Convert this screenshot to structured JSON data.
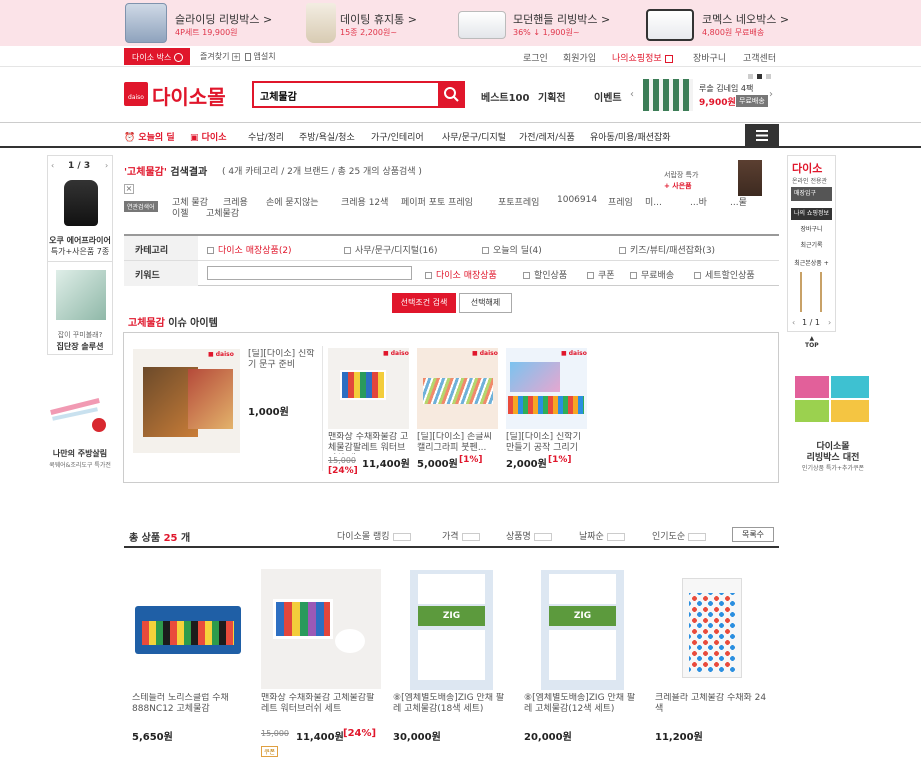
{
  "top_banner": [
    {
      "title": "슬라이딩 리빙박스 >",
      "sub": "4P세트 19,900원"
    },
    {
      "title": "데이팅 휴지통 >",
      "sub": "15종 2,200원~"
    },
    {
      "title": "모던핸들 리빙박스 >",
      "sub": "36% ↓ 1,900원~"
    },
    {
      "title": "코멕스 네오박스 >",
      "sub": "4,800원 무료배송"
    }
  ],
  "util": {
    "daiso_box": "다이소 박스",
    "bookmark": "즐겨찾기",
    "app": "앱설치",
    "login": "로그인",
    "join": "회원가입",
    "myinfo": "나의쇼핑정보",
    "cart": "장바구니",
    "support": "고객센터"
  },
  "header": {
    "logo_text": "다이소몰",
    "logo_badge": "daiso",
    "search_value": "고체물감",
    "links": [
      "베스트100",
      "기획전",
      "이벤트"
    ],
    "ad_title": "루솔 김네임 4팩",
    "ad_price": "9,900원",
    "ad_badge": "무료배송"
  },
  "gnb": {
    "deal": "오늘의 딜",
    "daiso": "다이소",
    "items": [
      "수납/정리",
      "주방/욕실/청소",
      "가구/인테리어",
      "사무/문구/디지털",
      "가전/레저/식품",
      "유아동/미용/패션잡화"
    ]
  },
  "left": {
    "pager": "1 / 3",
    "promo1_title": "오쿠 에어프라이어",
    "promo1_sub": "특가+사은품 7종",
    "promo2_sub": "잡이 꾸미볼래?",
    "promo2_title": "집단장 솔루션",
    "promo3_title": "나만의 주방살림",
    "promo3_sub": "쿡웨어&조리도구 특가전"
  },
  "search": {
    "title_keyword": "'고체물감'",
    "title_rest": " 검색결과",
    "summary": "( 4개 카테고리 / 2개 브랜드 / 총 25 개의 상품검색 )",
    "close": "×",
    "related_label": "연관검색어",
    "related": [
      "고체 물감",
      "크레용",
      "손에 묻지않는",
      "크레용 12색",
      "페이퍼 포토 프레임",
      "포토프레임",
      "1006914",
      "프레임",
      "미...",
      "...바",
      "...물"
    ],
    "related_line2": [
      "이젤",
      "고체물감"
    ],
    "ad_text": "서랍장 특가",
    "ad_sub": "+ 사은품"
  },
  "filter": {
    "category_label": "카테고리",
    "categories": [
      "다이소 매장상품(2)",
      "사무/문구/디지털(16)",
      "오늘의 딜(4)",
      "키즈/뷰티/패션잡화(3)"
    ],
    "keyword_label": "키워드",
    "keyword_value": "",
    "options": [
      "다이소 매장상품",
      "할인상품",
      "쿠폰",
      "무료배송",
      "세트할인상품"
    ],
    "search_btn": "선택조건 검색",
    "reset_btn": "선택해제"
  },
  "issue": {
    "keyword": "고체물감",
    "title": " 이슈 아이템",
    "main": {
      "name": "[딜][다이소] 신학기 문구 준비",
      "price": "1,000원"
    },
    "items": [
      {
        "name": "맨화상 수채화물감 고체물감팔레트 워터브러쉬 세트",
        "orig": "15,000",
        "price": "11,400원",
        "disc": "[24%]"
      },
      {
        "name": "[딜][다이소] 손글씨 캘리그라피 붓펜...",
        "orig": "",
        "price": "5,000원",
        "disc": "[1%]"
      },
      {
        "name": "[딜][다이소] 신학기 만들기 공작 그리기",
        "orig": "",
        "price": "2,000원",
        "disc": "[1%]"
      }
    ]
  },
  "results": {
    "total_label": "총 상품",
    "total_count": "25",
    "unit": "개",
    "sorts": [
      "다이소몰 랭킹",
      "가격",
      "상품명",
      "날짜순",
      "인기도순"
    ],
    "view_btn": "목록수"
  },
  "products": [
    {
      "name": "스테들러 노리스클럽 수채 888NC12 고체물감",
      "price": "5,650원",
      "orig": "",
      "disc": "",
      "badge": ""
    },
    {
      "name": "맨화상 수채화물감 고체물감팔레트 워터브러쉬 세트",
      "price": "11,400원",
      "orig": "15,000",
      "disc": "[24%]",
      "badge": "쿠폰"
    },
    {
      "name": "⑧[엠체별도배송]ZIG 안채 팔레 고체물감(18색 세트)",
      "price": "30,000원",
      "orig": "",
      "disc": "",
      "badge": ""
    },
    {
      "name": "⑧[엠체별도배송]ZIG 안채 팔레 고체물감(12색 세트)",
      "price": "20,000원",
      "orig": "",
      "disc": "",
      "badge": ""
    },
    {
      "name": "크레욜라 고체물감 수채화 24색",
      "price": "11,200원",
      "orig": "",
      "disc": "",
      "badge": ""
    }
  ],
  "right": {
    "logo": "다이소",
    "logo_sub": "온라인 전용관",
    "store": "매장입구",
    "menu": [
      "나의 쇼핑정보",
      "장바구니",
      "최근기록"
    ],
    "recent": "최근본상품 +",
    "pager": "1 / 1",
    "top": "TOP",
    "promo_title": "다이소몰",
    "promo_title2": "리빙박스 대전",
    "promo_sub": "인기상품 특가+추가쿠폰"
  },
  "colors": {
    "brand": "#e0162b",
    "dark": "#333333"
  }
}
